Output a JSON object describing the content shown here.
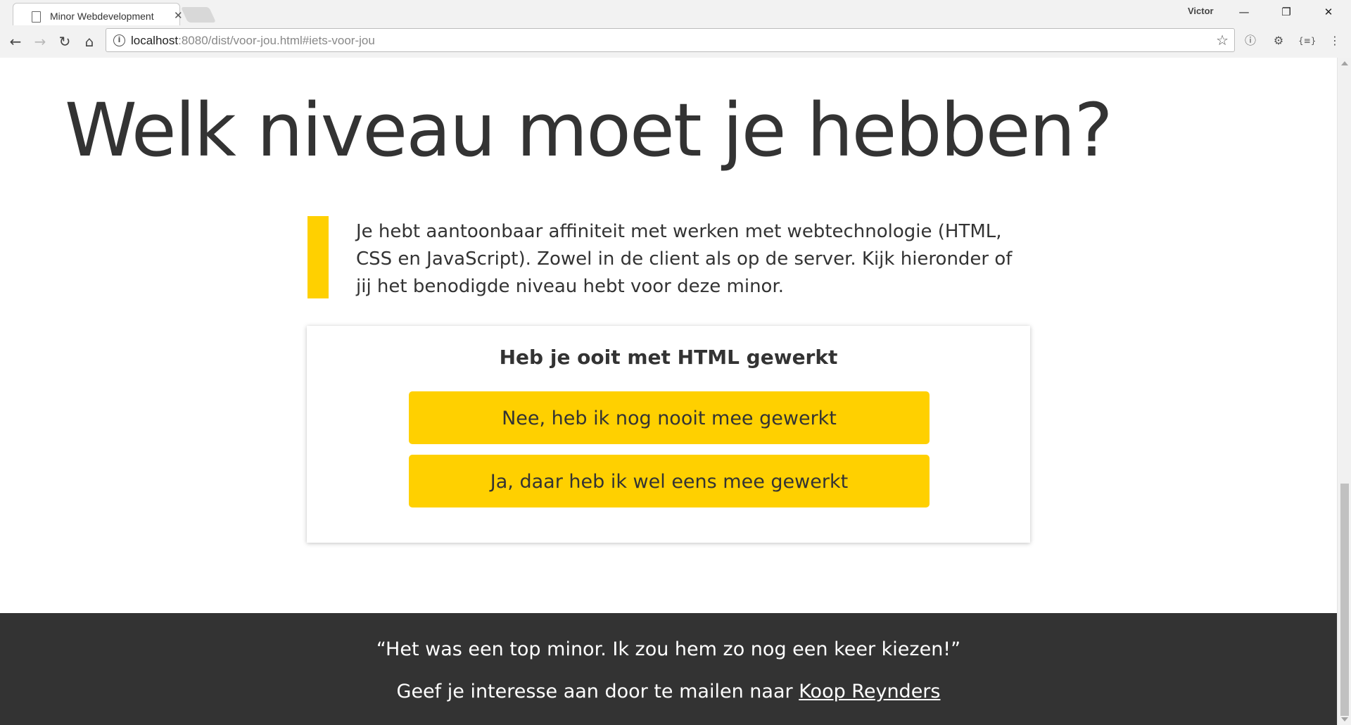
{
  "browser": {
    "tab_title": "Minor Webdevelopment",
    "profile_name": "Victor",
    "url_host": "localhost",
    "url_rest": ":8080/dist/voor-jou.html#iets-voor-jou"
  },
  "page": {
    "heading": "Welk niveau moet je hebben?",
    "intro": "Je hebt aantoonbaar affiniteit met werken met webtechnologie (HTML, CSS en JavaScript). Zowel in de client als op de server. Kijk hieronder of jij het benodigde niveau hebt voor deze minor.",
    "accent_color": "#ffd000",
    "quiz": {
      "question": "Heb je ooit met HTML gewerkt",
      "answers": [
        "Nee, heb ik nog nooit mee gewerkt",
        "Ja, daar heb ik wel eens mee gewerkt"
      ]
    }
  },
  "footer": {
    "testimonial": "“Het was een top minor. Ik zou hem zo nog een keer kiezen!”",
    "contact_prefix": "Geef je interesse aan door te mailen naar",
    "contact_link": "Koop Reynders",
    "background_color": "#333333"
  }
}
